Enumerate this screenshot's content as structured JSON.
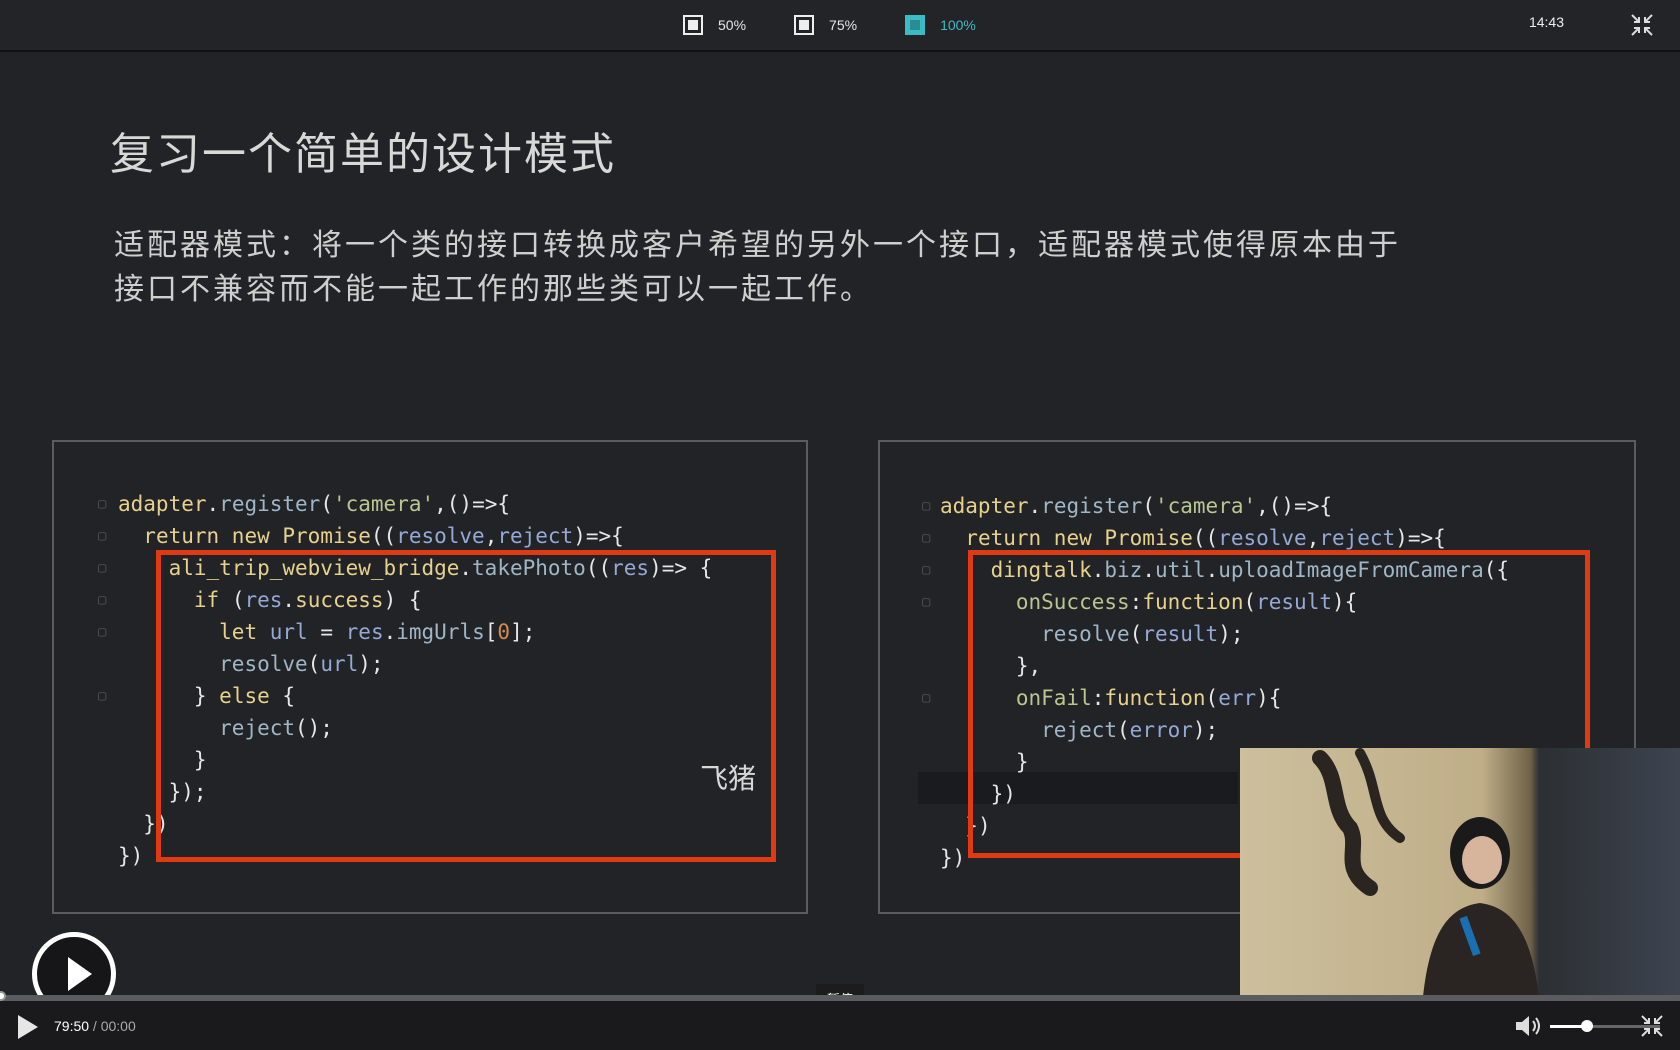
{
  "topbar": {
    "zoom_options": [
      {
        "label": "50%",
        "active": false
      },
      {
        "label": "75%",
        "active": false
      },
      {
        "label": "100%",
        "active": true
      }
    ],
    "clock": "14:43",
    "exit_icon": "shrink-arrows-icon"
  },
  "slide": {
    "title": "复习一个简单的设计模式",
    "text_line1": "适配器模式：将一个类的接口转换成客户希望的另外一个接口，适配器模式使得原本由于",
    "text_line2": "接口不兼容而不能一起工作的那些类可以一起工作。",
    "left_caption": "飞猪"
  },
  "overlay": {
    "tooltip": "暂停",
    "play_icon": "play-circle-icon"
  },
  "controls": {
    "current_time": "79:50",
    "separator": " / ",
    "total_time": "00:00",
    "progress_fraction": 0.0,
    "volume_fraction": 0.34,
    "volume_icon": "speaker-icon",
    "fullscreen_icon": "exit-fullscreen-icon"
  },
  "colors": {
    "accent": "#3bbcc4",
    "highlight_box": "#e03a14"
  }
}
